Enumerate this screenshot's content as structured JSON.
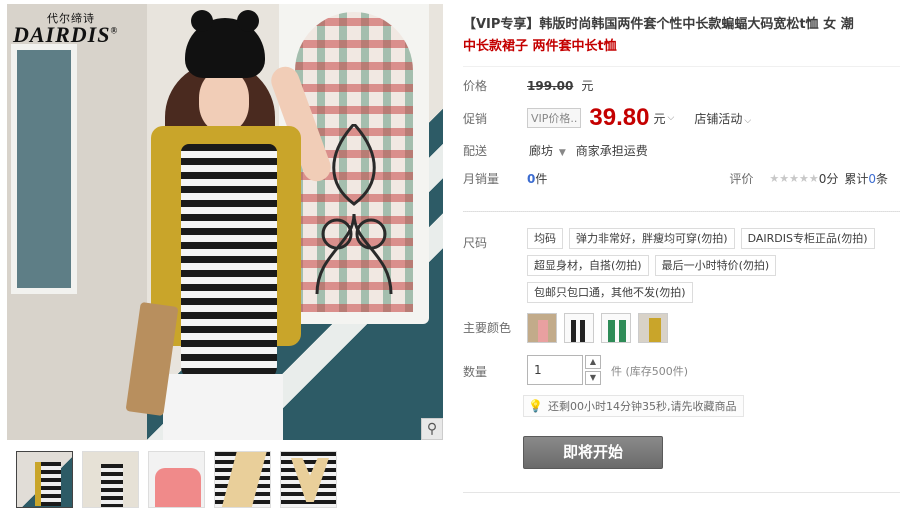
{
  "brand": {
    "logo_cn": "代尔缔诗",
    "logo_en": "DAIRDIS",
    "logo_reg": "®"
  },
  "gallery": {
    "zoom_icon": "magnifier-icon",
    "thumbnails": [
      "thumbnail-1",
      "thumbnail-2",
      "thumbnail-3",
      "thumbnail-4",
      "thumbnail-5"
    ]
  },
  "product": {
    "title_main": "【VIP专享】韩版时尚韩国两件套个性中长款蝙蝠大码宽松t恤 女 潮",
    "title_sub": "中长款裙子 两件套中长t恤"
  },
  "price": {
    "label": "价格",
    "original": "199.00",
    "unit": "元"
  },
  "promo": {
    "label": "促销",
    "vip_tag": "VIP价格..",
    "price": "39.80",
    "unit": "元",
    "shop_activity": "店铺活动"
  },
  "shipping": {
    "label": "配送",
    "from": "廊坊",
    "note": "商家承担运费"
  },
  "sales": {
    "label": "月销量",
    "count": "0",
    "count_unit": "件",
    "rating_label": "评价",
    "stars": "★★★★★",
    "score": "0分",
    "total_prefix": "累计",
    "total_count": "0",
    "total_suffix": "条"
  },
  "size": {
    "label": "尺码",
    "options": [
      "均码",
      "弹力非常好，胖瘦均可穿(勿拍)",
      "DAIRDIS专柜正品(勿拍)",
      "超显身材，自搭(勿拍)",
      "最后一小时特价(勿拍)",
      "包邮只包口通，其他不发(勿拍)"
    ]
  },
  "color": {
    "label": "主要颜色",
    "swatches": [
      "swatch-1",
      "swatch-2",
      "swatch-3",
      "swatch-4"
    ]
  },
  "quantity": {
    "label": "数量",
    "value": "1",
    "up": "▲",
    "down": "▼",
    "stock": "件 (库存500件)"
  },
  "tip": {
    "icon": "lightbulb-icon",
    "text": "还剩00小时14分钟35秒,请先收藏商品"
  },
  "buy_button": "即将开始",
  "colors": {
    "accent_red": "#c40000",
    "link_blue": "#3c6cd0",
    "button_gray": "#757575"
  }
}
